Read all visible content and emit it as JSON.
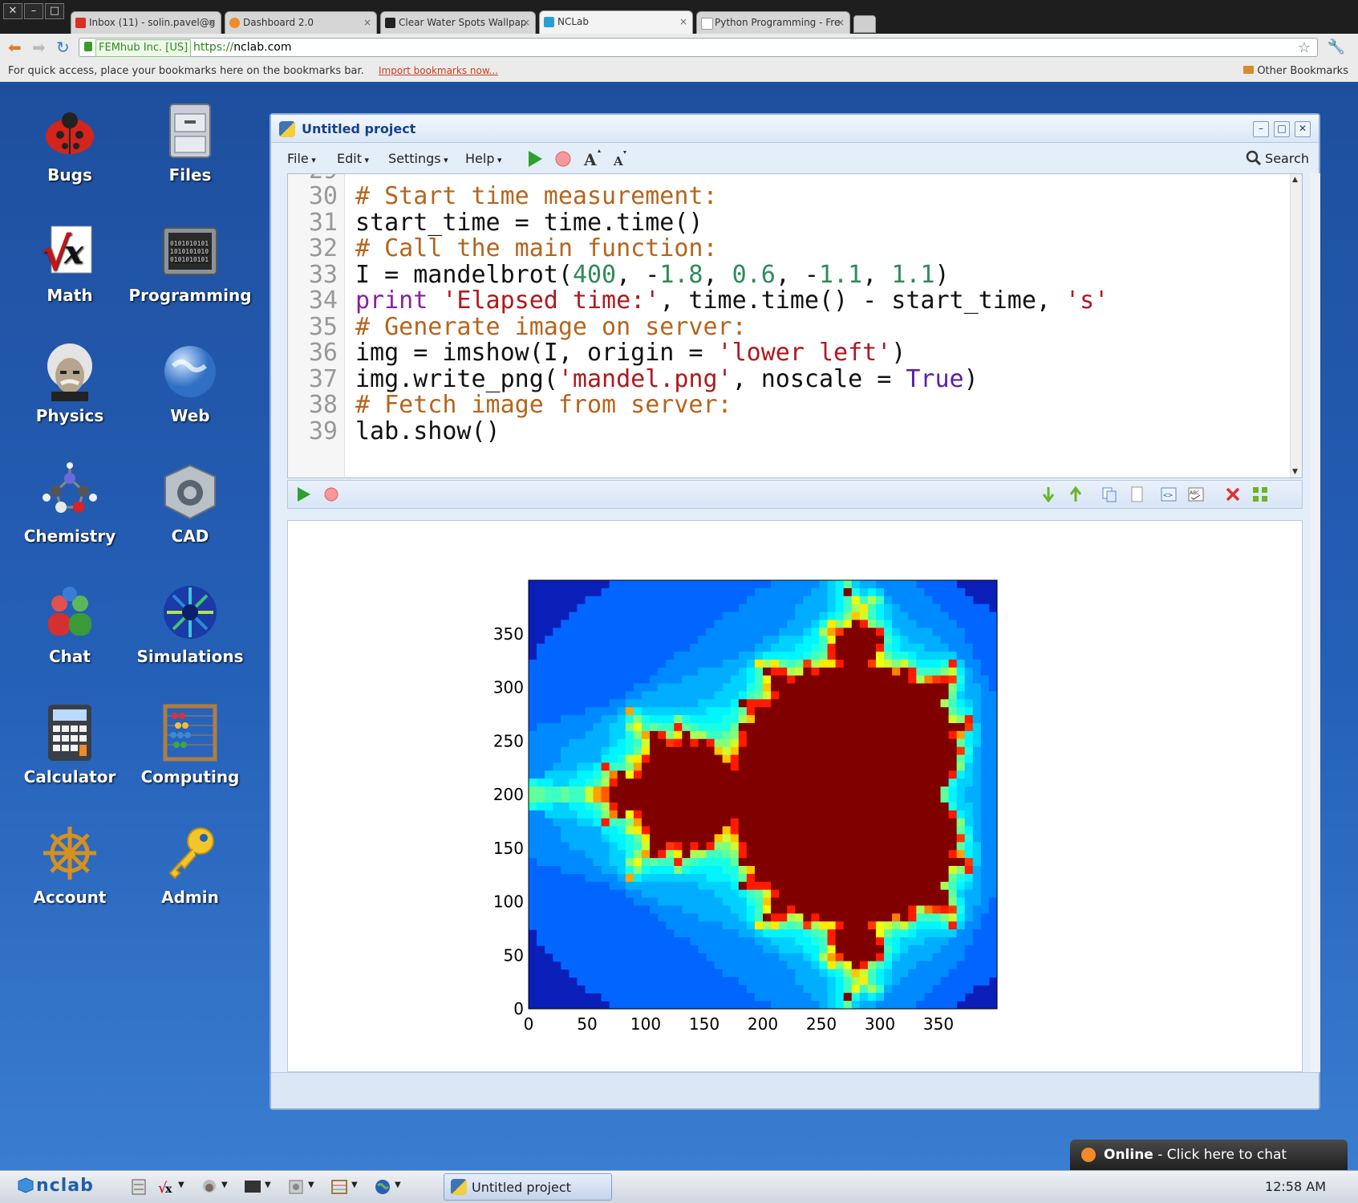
{
  "browser": {
    "tabs": [
      {
        "label": "Inbox (11) - solin.pavel@g",
        "icon_color": "#d93025",
        "active": false
      },
      {
        "label": "Dashboard 2.0",
        "icon_color": "#f08a2a",
        "active": false
      },
      {
        "label": "Clear Water Spots Wallpap",
        "icon_color": "#222222",
        "active": false
      },
      {
        "label": "NCLab",
        "icon_color": "#2a9fd6",
        "active": true
      },
      {
        "label": "Python Programming - Fre",
        "icon_color": "#ffffff",
        "active": false
      }
    ],
    "ev_badge": "FEMhub Inc. [US]",
    "url_scheme": "https://",
    "url_host": "nclab.com",
    "bookmarks_hint": "For quick access, place your bookmarks here on the bookmarks bar.",
    "import_link": "Import bookmarks now...",
    "other_bookmarks": "Other Bookmarks"
  },
  "desktop": {
    "icons": [
      {
        "label": "Bugs",
        "icon": "ladybug-icon"
      },
      {
        "label": "Files",
        "icon": "file-cabinet-icon"
      },
      {
        "label": "Math",
        "icon": "square-root-icon"
      },
      {
        "label": "Programming",
        "icon": "binary-screen-icon"
      },
      {
        "label": "Physics",
        "icon": "einstein-icon"
      },
      {
        "label": "Web",
        "icon": "globe-icon"
      },
      {
        "label": "Chemistry",
        "icon": "molecule-icon"
      },
      {
        "label": "CAD",
        "icon": "cad-cube-icon"
      },
      {
        "label": "Chat",
        "icon": "chat-people-icon"
      },
      {
        "label": "Simulations",
        "icon": "simulation-icon"
      },
      {
        "label": "Calculator",
        "icon": "calculator-icon"
      },
      {
        "label": "Computing",
        "icon": "abacus-icon"
      },
      {
        "label": "Account",
        "icon": "ship-wheel-icon"
      },
      {
        "label": "Admin",
        "icon": "key-icon"
      }
    ]
  },
  "app": {
    "title": "Untitled project",
    "menus": [
      "File",
      "Edit",
      "Settings",
      "Help"
    ],
    "search_label": "Search",
    "code_lines": [
      {
        "n": "30",
        "parts": [
          [
            "cm",
            "# Start time measurement:"
          ]
        ]
      },
      {
        "n": "31",
        "parts": [
          [
            "",
            "start_time = time.time()"
          ]
        ]
      },
      {
        "n": "32",
        "parts": [
          [
            "cm",
            "# Call the main function:"
          ]
        ]
      },
      {
        "n": "33",
        "parts": [
          [
            "",
            "I = mandelbrot("
          ],
          [
            "nm",
            "400"
          ],
          [
            "",
            ", -"
          ],
          [
            "nm",
            "1.8"
          ],
          [
            "",
            ", "
          ],
          [
            "nm",
            "0.6"
          ],
          [
            "",
            ", -"
          ],
          [
            "nm",
            "1.1"
          ],
          [
            "",
            ", "
          ],
          [
            "nm",
            "1.1"
          ],
          [
            "",
            ")"
          ]
        ]
      },
      {
        "n": "34",
        "parts": [
          [
            "kw",
            "print"
          ],
          [
            "",
            " "
          ],
          [
            "st",
            "'Elapsed time:'"
          ],
          [
            "",
            ", time.time() - start_time, "
          ],
          [
            "st",
            "'s'"
          ]
        ]
      },
      {
        "n": "35",
        "parts": [
          [
            "cm",
            "# Generate image on server:"
          ]
        ]
      },
      {
        "n": "36",
        "parts": [
          [
            "",
            "img = imshow(I, origin = "
          ],
          [
            "st",
            "'lower left'"
          ],
          [
            "",
            ")"
          ]
        ]
      },
      {
        "n": "37",
        "parts": [
          [
            "",
            "img.write_png("
          ],
          [
            "st",
            "'mandel.png'"
          ],
          [
            "",
            ", noscale = "
          ],
          [
            "bi",
            "True"
          ],
          [
            "",
            ")"
          ]
        ]
      },
      {
        "n": "38",
        "parts": [
          [
            "cm",
            "# Fetch image from server:"
          ]
        ]
      },
      {
        "n": "39",
        "parts": [
          [
            "",
            "lab.show()"
          ]
        ]
      }
    ]
  },
  "chart_data": {
    "type": "heatmap",
    "x_ticks": [
      "0",
      "50",
      "100",
      "150",
      "200",
      "250",
      "300",
      "350"
    ],
    "y_ticks": [
      "0",
      "50",
      "100",
      "150",
      "200",
      "250",
      "300",
      "350"
    ],
    "xlim": [
      0,
      400
    ],
    "ylim": [
      0,
      400
    ],
    "colormap": "jet",
    "extent": [
      -1.8,
      0.6,
      -1.1,
      1.1
    ],
    "colors": {
      "inside": "#800000",
      "background": "#0a1fb8"
    }
  },
  "taskbar": {
    "logo": "nclab",
    "window_button": "Untitled project",
    "clock": "12:58 AM"
  },
  "chat_popup": {
    "status": "Online",
    "message": " - Click here to chat"
  }
}
